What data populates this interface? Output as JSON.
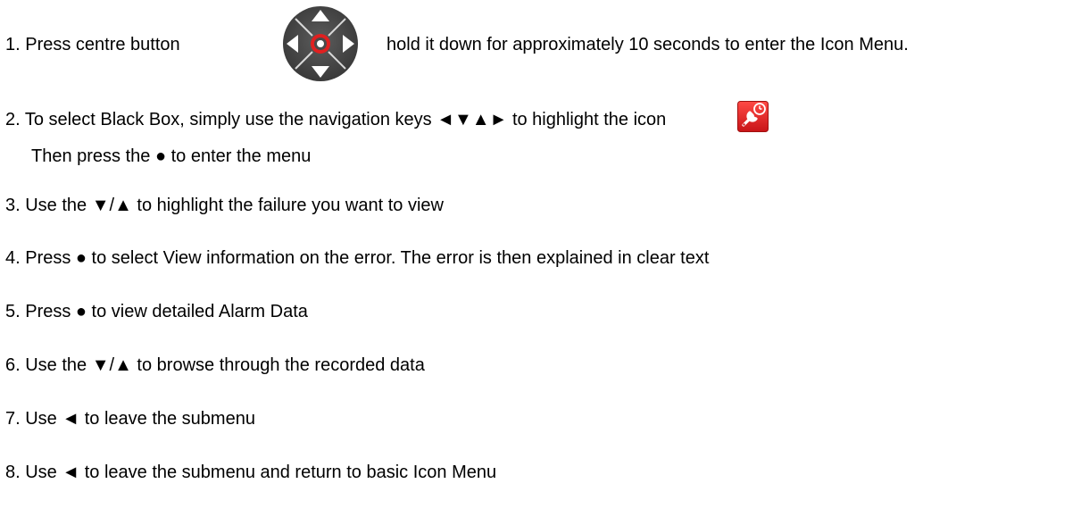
{
  "step1": {
    "before_icon": "1. Press centre button",
    "icon": "navigation-pad-icon",
    "after_icon": "hold it down for approximately 10 seconds to enter the Icon Menu."
  },
  "step2": {
    "before_icon": "2. To select Black Box, simply use the navigation keys ◄▼▲► to highlight the icon",
    "icon": "black-box-tool-icon",
    "continuation": "Then press the ● to enter the menu"
  },
  "step3": "3. Use the ▼/▲ to highlight the failure you want to view",
  "step4": "4. Press ● to select View information on the error. The error is then explained in clear text",
  "step5": "5. Press ● to view detailed Alarm Data",
  "step6": "6. Use the ▼/▲ to browse through the recorded data",
  "step7": "7. Use ◄ to leave the submenu",
  "step8": "8. Use ◄ to leave the submenu and return to basic Icon Menu",
  "colors": {
    "pad_fill": "#4a4a4a",
    "pad_ring": "#e02020",
    "icon_red": "#e8262a"
  }
}
